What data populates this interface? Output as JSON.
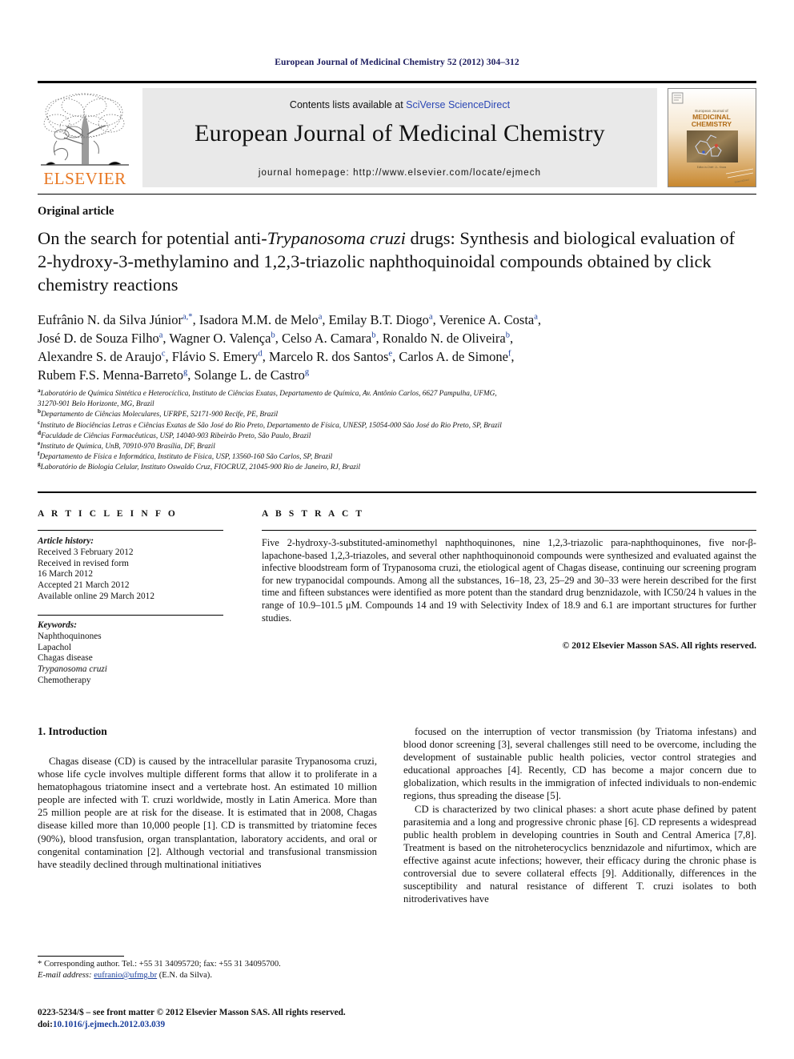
{
  "running_head": "European Journal of Medicinal Chemistry 52 (2012) 304–312",
  "masthead": {
    "contents_prefix": "Contents lists available at ",
    "contents_link": "SciVerse ScienceDirect",
    "journal_title": "European Journal of Medicinal Chemistry",
    "homepage_label": "journal homepage: http://www.elsevier.com/locate/ejmech",
    "publisher_wordmark": "ELSEVIER",
    "cover": {
      "line1": "European Journal of",
      "line2": "MEDICINAL",
      "line3": "CHEMISTRY",
      "caption": "Editor-in-Chief: J.L. Kraus"
    },
    "accent_orange": "#E87722",
    "link_blue": "#2b47b5"
  },
  "article": {
    "type": "Original article",
    "title_parts": [
      {
        "text": "On the search for potential anti-",
        "italic": false
      },
      {
        "text": "Trypanosoma cruzi",
        "italic": true
      },
      {
        "text": " drugs: Synthesis and biological evaluation of 2-hydroxy-3-methylamino and 1,2,3-triazolic naphthoquinoidal compounds obtained by click chemistry reactions",
        "italic": false
      }
    ],
    "title_plain": "On the search for potential anti-Trypanosoma cruzi drugs: Synthesis and biological evaluation of 2-hydroxy-3-methylamino and 1,2,3-triazolic naphthoquinoidal compounds obtained by click chemistry reactions",
    "authors": [
      {
        "name": "Eufrânio N. da Silva Júnior",
        "marks": "a,*"
      },
      {
        "name": "Isadora M.M. de Melo",
        "marks": "a"
      },
      {
        "name": "Emilay B.T. Diogo",
        "marks": "a"
      },
      {
        "name": "Verenice A. Costa",
        "marks": "a"
      },
      {
        "name": "José D. de Souza Filho",
        "marks": "a"
      },
      {
        "name": "Wagner O. Valença",
        "marks": "b"
      },
      {
        "name": "Celso A. Camara",
        "marks": "b"
      },
      {
        "name": "Ronaldo N. de Oliveira",
        "marks": "b"
      },
      {
        "name": "Alexandre S. de Araujo",
        "marks": "c"
      },
      {
        "name": "Flávio S. Emery",
        "marks": "d"
      },
      {
        "name": "Marcelo R. dos Santos",
        "marks": "e"
      },
      {
        "name": "Carlos A. de Simone",
        "marks": "f"
      },
      {
        "name": "Rubem F.S. Menna-Barreto",
        "marks": "g"
      },
      {
        "name": "Solange L. de Castro",
        "marks": "g"
      }
    ],
    "affiliations": [
      {
        "mark": "a",
        "lines": [
          "Laboratório de Química Sintética e Heterocíclica, Instituto de Ciências Exatas, Departamento de Química, Av. Antônio Carlos, 6627 Pampulha, UFMG,",
          "31270-901 Belo Horizonte, MG, Brazil"
        ]
      },
      {
        "mark": "b",
        "lines": [
          "Departamento de Ciências Moleculares, UFRPE, 52171-900 Recife, PE, Brazil"
        ]
      },
      {
        "mark": "c",
        "lines": [
          "Instituto de Biociências Letras e Ciências Exatas de São José do Rio Preto, Departamento de Física, UNESP, 15054-000 São José do Rio Preto, SP, Brazil"
        ]
      },
      {
        "mark": "d",
        "lines": [
          "Faculdade de Ciências Farmacêuticas, USP, 14040-903 Ribeirão Preto, São Paulo, Brazil"
        ]
      },
      {
        "mark": "e",
        "lines": [
          "Instituto de Química, UnB, 70910-970 Brasília, DF, Brazil"
        ]
      },
      {
        "mark": "f",
        "lines": [
          "Departamento de Física e Informática, Instituto de Física, USP, 13560-160 São Carlos, SP, Brazil"
        ]
      },
      {
        "mark": "g",
        "lines": [
          "Laboratório de Biologia Celular, Instituto Oswaldo Cruz, FIOCRUZ, 21045-900 Rio de Janeiro, RJ, Brazil"
        ]
      }
    ]
  },
  "info": {
    "heading": "A R T I C L E   I N F O",
    "history_label": "Article history:",
    "history": [
      "Received 3 February 2012",
      "Received in revised form",
      "16 March 2012",
      "Accepted 21 March 2012",
      "Available online 29 March 2012"
    ],
    "keywords_label": "Keywords:",
    "keywords": [
      {
        "text": "Naphthoquinones",
        "italic": false
      },
      {
        "text": "Lapachol",
        "italic": false
      },
      {
        "text": "Chagas disease",
        "italic": false
      },
      {
        "text": "Trypanosoma cruzi",
        "italic": true
      },
      {
        "text": "Chemotherapy",
        "italic": false
      }
    ]
  },
  "abstract": {
    "heading": "A B S T R A C T",
    "text": "Five 2-hydroxy-3-substituted-aminomethyl naphthoquinones, nine 1,2,3-triazolic para-naphthoquinones, five nor-β-lapachone-based 1,2,3-triazoles, and several other naphthoquinonoid compounds were synthesized and evaluated against the infective bloodstream form of Trypanosoma cruzi, the etiological agent of Chagas disease, continuing our screening program for new trypanocidal compounds. Among all the substances, 16–18, 23, 25–29 and 30–33 were herein described for the first time and fifteen substances were identified as more potent than the standard drug benznidazole, with IC50/24 h values in the range of 10.9–101.5 μM. Compounds 14 and 19 with Selectivity Index of 18.9 and 6.1 are important structures for further studies.",
    "copyright": "© 2012 Elsevier Masson SAS. All rights reserved."
  },
  "body": {
    "section_title": "1. Introduction",
    "left_paragraph": "Chagas disease (CD) is caused by the intracellular parasite Trypanosoma cruzi, whose life cycle involves multiple different forms that allow it to proliferate in a hematophagous triatomine insect and a vertebrate host. An estimated 10 million people are infected with T. cruzi worldwide, mostly in Latin America. More than 25 million people are at risk for the disease. It is estimated that in 2008, Chagas disease killed more than 10,000 people [1]. CD is transmitted by triatomine feces (90%), blood transfusion, organ transplantation, laboratory accidents, and oral or congenital contamination [2]. Although vectorial and transfusional transmission have steadily declined through multinational initiatives",
    "right_paragraph_1": "focused on the interruption of vector transmission (by Triatoma infestans) and blood donor screening [3], several challenges still need to be overcome, including the development of sustainable public health policies, vector control strategies and educational approaches [4]. Recently, CD has become a major concern due to globalization, which results in the immigration of infected individuals to non-endemic regions, thus spreading the disease [5].",
    "right_paragraph_2": "CD is characterized by two clinical phases: a short acute phase defined by patent parasitemia and a long and progressive chronic phase [6]. CD represents a widespread public health problem in developing countries in South and Central America [7,8]. Treatment is based on the nitroheterocyclics benznidazole and nifurtimox, which are effective against acute infections; however, their efficacy during the chronic phase is controversial due to severe collateral effects [9]. Additionally, differences in the susceptibility and natural resistance of different T. cruzi isolates to both nitroderivatives have"
  },
  "footnote": {
    "corresponding": "* Corresponding author. Tel.: +55 31 34095720; fax: +55 31 34095700.",
    "email_label": "E-mail address:",
    "email": "eufranio@ufmg.br",
    "email_owner": "(E.N. da Silva)."
  },
  "footer": {
    "issn_line": "0223-5234/$ – see front matter © 2012 Elsevier Masson SAS. All rights reserved.",
    "doi_label": "doi:",
    "doi": "10.1016/j.ejmech.2012.03.039"
  }
}
